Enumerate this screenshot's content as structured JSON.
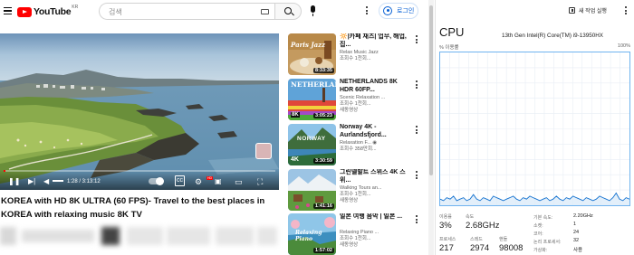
{
  "youtube": {
    "logo_text": "YouTube",
    "region_code": "KR",
    "search_placeholder": "검색",
    "signin_label": "로그인",
    "video": {
      "elapsed": "1:28",
      "duration": "3:13:12",
      "time_display": "1:28 / 3:13:12",
      "progress_fraction": 0.008,
      "title": "KOREA with HD 8K ULTRA (60 FPS)- Travel to the best places in KOREA with relaxing music 8K TV"
    },
    "recommendations": [
      {
        "title": "🔆|카페 재즈| 업무, 해업, 집...",
        "channel": "Relax Music Jazz",
        "meta": "조회수 1천회...",
        "duration": "8:33:35",
        "thumb_text": "Paris Jazz"
      },
      {
        "title": "NETHERLANDS 8K HDR 60FP...",
        "channel": "Scenic Relaxation ...",
        "meta": "조회수 1천회...",
        "meta2": "새동영상",
        "duration": "3:05:23",
        "thumb_text": "NETHERLANDS",
        "thumb_badge": "8K"
      },
      {
        "title": "Norway 4K - Aurlandsfjord...",
        "channel": "Relaxation F... ◉",
        "meta": "조회수 358만회...",
        "duration": "3:30:59",
        "thumb_text": "NORWAY",
        "thumb_badge": "4K"
      },
      {
        "title": "그린델발트 스위스 4K 스위...",
        "channel": "Walking Tours an...",
        "meta": "조회수 1천회...",
        "meta2": "새동영상",
        "duration": "1:41:16"
      },
      {
        "title": "일본 여행 음악 | 일본 ...",
        "channel": "Relaxing Piano ...",
        "meta": "조회수 1천회...",
        "meta2": "새동영상",
        "duration": "1:57:02",
        "thumb_text": "Relaxing Piano"
      }
    ]
  },
  "taskmanager": {
    "run_new_task": "새 작업 실행",
    "section_title": "CPU",
    "cpu_model": "13th Gen Intel(R) Core(TM) i9-13950HX",
    "util_label": "% 이용률",
    "graph_max": "100%",
    "stats": {
      "utilization_label": "이용률",
      "utilization": "3%",
      "speed_label": "속도",
      "speed": "2.68GHz",
      "processes_label": "프로세스",
      "processes": "217",
      "threads_label": "스레드",
      "threads": "2974",
      "handles_label": "핸들",
      "handles": "98008"
    },
    "specs": [
      {
        "key": "기본 속도:",
        "value": "2.20GHz"
      },
      {
        "key": "소켓:",
        "value": "1"
      },
      {
        "key": "코어:",
        "value": "24"
      },
      {
        "key": "논리 프로세서:",
        "value": "32"
      },
      {
        "key": "가상화:",
        "value": "사용"
      }
    ],
    "cpu_history": [
      4,
      3,
      5,
      4,
      6,
      3,
      4,
      5,
      3,
      4,
      7,
      4,
      3,
      5,
      4,
      3,
      6,
      5,
      4,
      3,
      4,
      5,
      6,
      4,
      3,
      5,
      4,
      6,
      5,
      4,
      3,
      4,
      5,
      3,
      4,
      6,
      4,
      3,
      5,
      4,
      6,
      5,
      4,
      3,
      5,
      4,
      3,
      4,
      6,
      5,
      4,
      3,
      5,
      8,
      4,
      3,
      5,
      4
    ]
  },
  "colors": {
    "youtube_red": "#ff0000",
    "link_blue": "#065fd4",
    "graph_stroke": "#1170cf",
    "graph_border": "#6fb3ef"
  }
}
